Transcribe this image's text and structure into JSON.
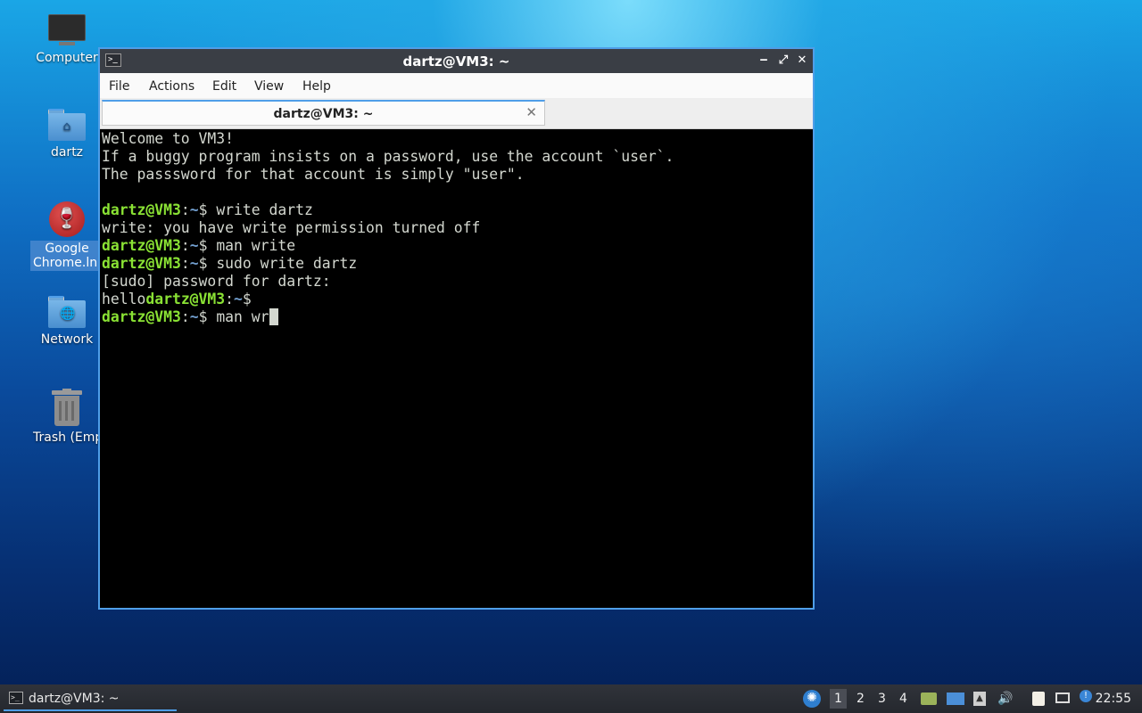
{
  "desktop": {
    "icons": [
      {
        "label": "Computer",
        "icon": "computer-icon"
      },
      {
        "label": "dartz",
        "icon": "home-folder-icon"
      },
      {
        "label": "Google Chrome.lnk",
        "label_line1": "Google",
        "label_line2": "Chrome.lnk",
        "icon": "wine-icon"
      },
      {
        "label": "Network",
        "icon": "network-folder-icon"
      },
      {
        "label": "Trash (Empty)",
        "label_visible": "Trash (Empt",
        "icon": "trash-icon"
      }
    ]
  },
  "window": {
    "title": "dartz@VM3: ~",
    "controls": {
      "minimize": "‒",
      "maximize": "⤢",
      "close": "✕"
    },
    "menu": [
      "File",
      "Actions",
      "Edit",
      "View",
      "Help"
    ],
    "tab": {
      "label": "dartz@VM3: ~",
      "close": "✕"
    },
    "terminal": {
      "lines": [
        {
          "text": "Welcome to VM3!"
        },
        {
          "text": "If a buggy program insists on a password, use the account `user`."
        },
        {
          "text": "The passsword for that account is simply \"user\"."
        },
        {
          "text": ""
        },
        {
          "prompt_user": "dartz@VM3",
          "prompt_colon": ":",
          "prompt_path": "~",
          "prompt_end": "$ ",
          "text": "write dartz"
        },
        {
          "text": "write: you have write permission turned off"
        },
        {
          "prompt_user": "dartz@VM3",
          "prompt_colon": ":",
          "prompt_path": "~",
          "prompt_end": "$ ",
          "text": "man write"
        },
        {
          "prompt_user": "dartz@VM3",
          "prompt_colon": ":",
          "prompt_path": "~",
          "prompt_end": "$ ",
          "text": "sudo write dartz"
        },
        {
          "text": "[sudo] password for dartz:"
        },
        {
          "prefix": "hello",
          "prompt_user": "dartz@VM3",
          "prompt_colon": ":",
          "prompt_path": "~",
          "prompt_end": "$",
          "text": ""
        },
        {
          "prompt_user": "dartz@VM3",
          "prompt_colon": ":",
          "prompt_path": "~",
          "prompt_end": "$ ",
          "text": "man wr",
          "cursor": true
        }
      ]
    }
  },
  "taskbar": {
    "task": {
      "label": "dartz@VM3: ~"
    },
    "desktops": [
      "1",
      "2",
      "3",
      "4"
    ],
    "active_desktop": "1",
    "tray_icons": [
      "lxqt-icon",
      "files-icon",
      "display-icon",
      "eject-icon",
      "volume-icon",
      "clipboard-icon",
      "network-icon",
      "update-icon"
    ],
    "clock": "22:55"
  },
  "colors": {
    "accent": "#4f9ee8",
    "prompt_user": "#8ae234",
    "prompt_path": "#729fcf",
    "terminal_fg": "#d3d7cf",
    "terminal_bg": "#000000"
  }
}
